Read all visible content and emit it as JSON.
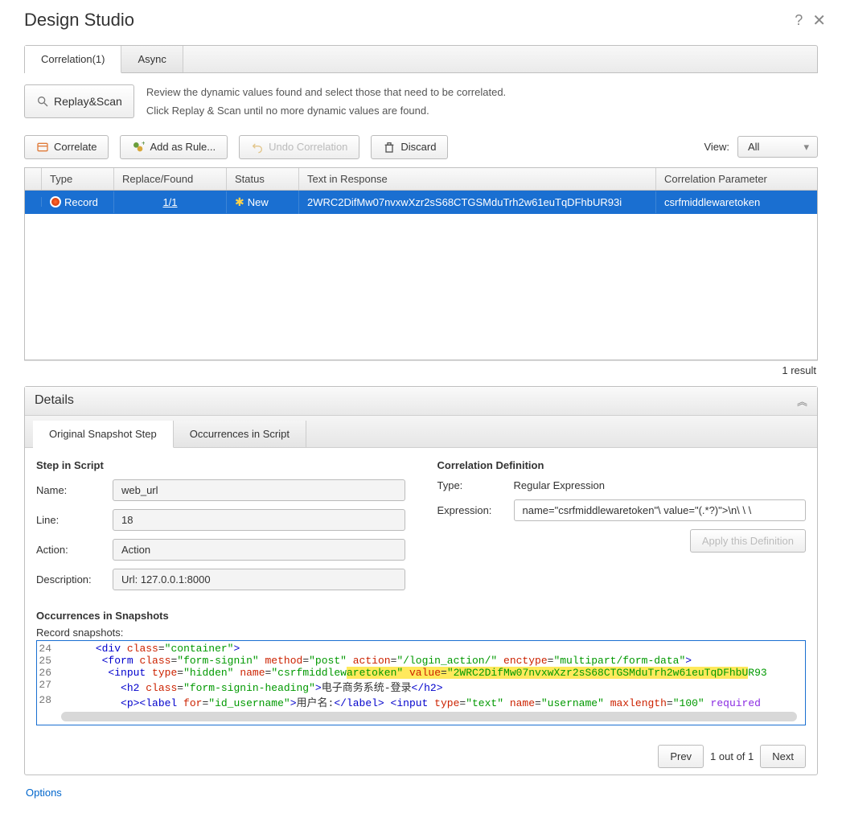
{
  "title": "Design Studio",
  "mainTabs": {
    "correlation": "Correlation(1)",
    "async": "Async"
  },
  "hints": {
    "line1": "Review the dynamic values found and select those that need to be correlated.",
    "line2": "Click Replay & Scan until no more dynamic values are found."
  },
  "buttons": {
    "replayScan": "Replay&Scan",
    "correlate": "Correlate",
    "addAsRule": "Add as Rule...",
    "undoCorrelation": "Undo Correlation",
    "discard": "Discard",
    "applyDefinition": "Apply this Definition",
    "prev": "Prev",
    "next": "Next"
  },
  "viewLabel": "View:",
  "viewValue": "All",
  "grid": {
    "headers": {
      "type": "Type",
      "replace": "Replace/Found",
      "status": "Status",
      "text": "Text in Response",
      "param": "Correlation Parameter"
    },
    "row": {
      "type": "Record",
      "replace": "1/1",
      "status": "New",
      "text": "2WRC2DifMw07nvxwXzr2sS68CTGSMduTrh2w61euTqDFhbUR93i",
      "param": "csrfmiddlewaretoken"
    }
  },
  "resultCount": "1 result",
  "details": {
    "title": "Details",
    "tabs": {
      "orig": "Original Snapshot Step",
      "occ": "Occurrences in Script"
    },
    "step": {
      "heading": "Step in Script",
      "nameLabel": "Name:",
      "name": "web_url",
      "lineLabel": "Line:",
      "line": "18",
      "actionLabel": "Action:",
      "action": "Action",
      "descLabel": "Description:",
      "desc": "Url: 127.0.0.1:8000"
    },
    "corr": {
      "heading": "Correlation Definition",
      "typeLabel": "Type:",
      "type": "Regular Expression",
      "exprLabel": "Expression:",
      "expr": "name=\"csrfmiddlewaretoken\"\\ value=\"(.*?)\">\\n\\ \\ \\"
    },
    "occHeading": "Occurrences in Snapshots",
    "recSnap": "Record snapshots:",
    "code": {
      "l24": {
        "n": "24"
      },
      "l25": {
        "n": "25"
      },
      "l26": {
        "n": "26",
        "hl_token": "aretoken\"",
        "hl_value": "\"2WRC2DifMw07nvxwXzr2sS68CTGSMduTrh2w61euTqDFhbU"
      },
      "l27": {
        "n": "27",
        "text": "电子商务系统-登录"
      },
      "l28": {
        "n": "28",
        "text": "用户名:"
      }
    },
    "pager": "1 out of 1"
  },
  "optionsLink": "Options"
}
